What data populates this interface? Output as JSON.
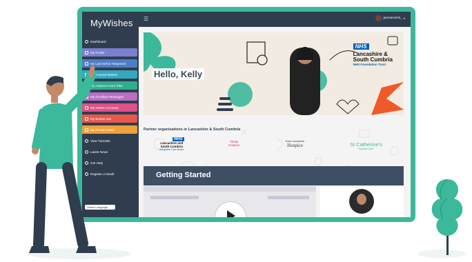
{
  "app": {
    "brand_name": "MyWishes"
  },
  "topbar": {
    "username": "jamesnorris_"
  },
  "sidebar": {
    "items": [
      {
        "label": "Dashboard",
        "color": ""
      },
      {
        "label": "My Profile",
        "color": "#7b7fcf"
      },
      {
        "label": "My Last Will & Testament",
        "color": "#4f7ec7"
      },
      {
        "label": "My Funeral Wishes",
        "color": "#35a8c0"
      },
      {
        "label": "My Advance Care Plan",
        "color": "#2fae8f"
      },
      {
        "label": "My Goodbye Messages",
        "color": "#b86fc4"
      },
      {
        "label": "My Online Accounts",
        "color": "#e0508a"
      },
      {
        "label": "My Bucket List",
        "color": "#e8584b"
      },
      {
        "label": "My Private Notes",
        "color": "#f0a13a"
      },
      {
        "label": "View Tutorials",
        "color": ""
      },
      {
        "label": "Latest News",
        "color": ""
      },
      {
        "label": "Get Help",
        "color": ""
      },
      {
        "label": "Register a Death",
        "color": ""
      }
    ],
    "language_label": "Select Language"
  },
  "banner": {
    "greeting": "Hello, Kelly",
    "nhs_badge": "NHS",
    "org_line1": "Lancashire &",
    "org_line2": "South Cumbria",
    "org_line3": "NHS Foundation Trust"
  },
  "partners": {
    "heading": "Partner organisations in Lancashire & South Cumbria",
    "logos": [
      {
        "badge": "NHS",
        "name1": "Lancashire and",
        "name2": "South Cumbria",
        "name3": "Integrated Care Board"
      },
      {
        "name1": "Trinity",
        "name2": "Hospice"
      },
      {
        "name1": "East Lancashire",
        "name2": "Hospice"
      },
      {
        "name1": "St Catherine's",
        "name2": "Hospice Care"
      }
    ]
  },
  "getting_started": {
    "title": "Getting Started"
  },
  "colors": {
    "frame": "#3cb89a",
    "sidebar": "#2f3d4e",
    "accent_orange": "#f05a28",
    "accent_green": "#3cb89a"
  }
}
